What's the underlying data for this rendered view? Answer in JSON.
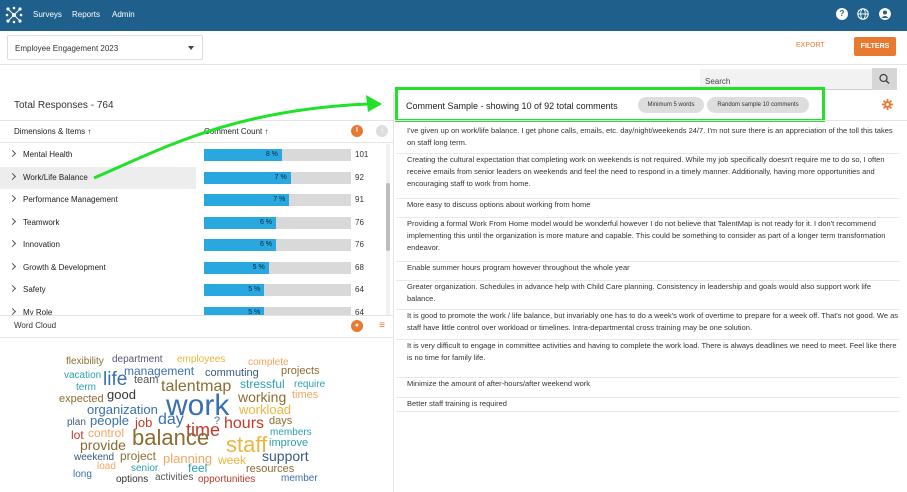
{
  "nav": {
    "links": [
      "Surveys",
      "Reports",
      "Admin"
    ],
    "icons": [
      "help-icon",
      "globe-icon",
      "user-icon"
    ]
  },
  "toolbar": {
    "survey_name": "Employee Engagement 2023",
    "export_label": "EXPORT",
    "filters_label": "FILTERS",
    "search_placeholder": "Search"
  },
  "left": {
    "total_responses": "Total Responses - 764",
    "col_dimensions": "Dimensions & Items",
    "col_count": "Comment Count",
    "dimensions": [
      {
        "label": "Mental Health",
        "pct": "8 %",
        "fraction": 0.53,
        "count": "101"
      },
      {
        "label": "Work/Life Balance",
        "pct": "7 %",
        "fraction": 0.59,
        "count": "92"
      },
      {
        "label": "Performance Management",
        "pct": "7 %",
        "fraction": 0.58,
        "count": "91"
      },
      {
        "label": "Teamwork",
        "pct": "6 %",
        "fraction": 0.49,
        "count": "76"
      },
      {
        "label": "Innovation",
        "pct": "6 %",
        "fraction": 0.49,
        "count": "76"
      },
      {
        "label": "Growth & Development",
        "pct": "5 %",
        "fraction": 0.44,
        "count": "68"
      },
      {
        "label": "Safety",
        "pct": "5 %",
        "fraction": 0.41,
        "count": "64"
      },
      {
        "label": "My Role",
        "pct": "5 %",
        "fraction": 0.41,
        "count": "64"
      }
    ],
    "selected_index": 1
  },
  "word_cloud": {
    "title": "Word Cloud",
    "words": [
      {
        "w": "flexibility",
        "c": "#8c6d31",
        "s": 10
      },
      {
        "w": "department",
        "c": "#555577",
        "s": 10
      },
      {
        "w": "employees",
        "c": "#f0b43c",
        "s": 10
      },
      {
        "w": "complete",
        "c": "#f4a460",
        "s": 10
      },
      {
        "w": "vacation",
        "c": "#2ca0b0",
        "s": 10
      },
      {
        "w": "life",
        "c": "#3a6fb0",
        "s": 19
      },
      {
        "w": "management",
        "c": "#3a6fb0",
        "s": 12
      },
      {
        "w": "commuting",
        "c": "#3a5a80",
        "s": 11
      },
      {
        "w": "projects",
        "c": "#8c6d31",
        "s": 11
      },
      {
        "w": "term",
        "c": "#2ca0b0",
        "s": 10
      },
      {
        "w": "team",
        "c": "#555",
        "s": 11
      },
      {
        "w": "talentmap",
        "c": "#8c6d31",
        "s": 16
      },
      {
        "w": "stressful",
        "c": "#2ca0b0",
        "s": 12
      },
      {
        "w": "require",
        "c": "#2ca0b0",
        "s": 10
      },
      {
        "w": "expected",
        "c": "#8c6d31",
        "s": 11
      },
      {
        "w": "good",
        "c": "#333",
        "s": 13
      },
      {
        "w": "working",
        "c": "#8c6d31",
        "s": 14
      },
      {
        "w": "times",
        "c": "#f4a460",
        "s": 11
      },
      {
        "w": "organization",
        "c": "#3a6fb0",
        "s": 13
      },
      {
        "w": "work",
        "c": "#3a6fb0",
        "s": 30
      },
      {
        "w": "workload",
        "c": "#f0b43c",
        "s": 13
      },
      {
        "w": "plan",
        "c": "#3a5a80",
        "s": 10
      },
      {
        "w": "people",
        "c": "#3a6fb0",
        "s": 13
      },
      {
        "w": "job",
        "c": "#c0392b",
        "s": 13
      },
      {
        "w": "day",
        "c": "#3a6fb0",
        "s": 16
      },
      {
        "w": "?",
        "c": "#3a6fb0",
        "s": 11
      },
      {
        "w": "hours",
        "c": "#c0392b",
        "s": 16
      },
      {
        "w": "days",
        "c": "#8c6d31",
        "s": 11
      },
      {
        "w": "lot",
        "c": "#c0392b",
        "s": 12
      },
      {
        "w": "control",
        "c": "#f4a460",
        "s": 12
      },
      {
        "w": "time",
        "c": "#c0392b",
        "s": 18
      },
      {
        "w": "members",
        "c": "#2ca0b0",
        "s": 10
      },
      {
        "w": "provide",
        "c": "#8c6d31",
        "s": 14
      },
      {
        "w": "balance",
        "c": "#8c6d31",
        "s": 22
      },
      {
        "w": "staff",
        "c": "#f0b43c",
        "s": 22
      },
      {
        "w": "improve",
        "c": "#2ca0b0",
        "s": 11
      },
      {
        "w": "weekend",
        "c": "#3a5a80",
        "s": 10
      },
      {
        "w": "project",
        "c": "#8c6d31",
        "s": 12
      },
      {
        "w": "planning",
        "c": "#f4a460",
        "s": 13
      },
      {
        "w": "week",
        "c": "#f0b43c",
        "s": 12
      },
      {
        "w": "support",
        "c": "#3a5a80",
        "s": 14
      },
      {
        "w": "load",
        "c": "#f4a460",
        "s": 10
      },
      {
        "w": "senior",
        "c": "#2ca0b0",
        "s": 10
      },
      {
        "w": "feel",
        "c": "#2ca0b0",
        "s": 12
      },
      {
        "w": "resources",
        "c": "#8c6d31",
        "s": 11
      },
      {
        "w": "long",
        "c": "#3a6fb0",
        "s": 10
      },
      {
        "w": "options",
        "c": "#333",
        "s": 10
      },
      {
        "w": "activities",
        "c": "#555",
        "s": 10
      },
      {
        "w": "opportunities",
        "c": "#c0392b",
        "s": 10
      },
      {
        "w": "member",
        "c": "#3a6fb0",
        "s": 10
      }
    ]
  },
  "comments_panel": {
    "title": "Comment Sample - showing 10 of 92 total comments",
    "chip_min_words": "Minimum 5 words",
    "chip_random": "Random sample 10 comments",
    "comments": [
      "I've given up on work/life balance. I get phone calls, emails, etc. day/night/weekends 24/7. I'm not sure there is an appreciation of the toll this takes on staff long term.",
      "Creating the cultural expectation that completing work on weekends is not required. While my job specifically doesn't require me to do so, I often receive emails from senior leaders on weekends and feel the need to respond in a timely manner. Additionally, having more opportunities and encouraging staff to work from home.",
      "More easy to discuss options about working from home",
      "Providing a formal Work From Home model would be wonderful however I do not believe that TalentMap is not ready for it. I don't recommend implementing this until the organization is more mature and capable. This could be something to consider as part of a longer term transformation endeavor.",
      "Enable summer hours program however throughout the whole year",
      "Greater organization. Schedules in advance help with Child Care planning. Consistency in leadership and goals would also support work life balance.",
      "It is good to promote the work / life balance, but invariably one has to do a week's work of overtime to prepare for a week off. That's not good. We as staff have little control over workload or timelines. Intra-departmental cross training may be one solution.",
      "It is very difficult to engage in committee activities and having to complete the work load. There is always deadlines we need to meet. Feel like there is no time for family life.",
      "Minimize the amount of after-hours/after weekend work",
      "Better staff training is required"
    ]
  },
  "colors": {
    "nav_bg": "#1e5f8c",
    "accent_orange": "#e87930",
    "bar_blue": "#29a8e0",
    "highlight_green": "#22e12a"
  }
}
